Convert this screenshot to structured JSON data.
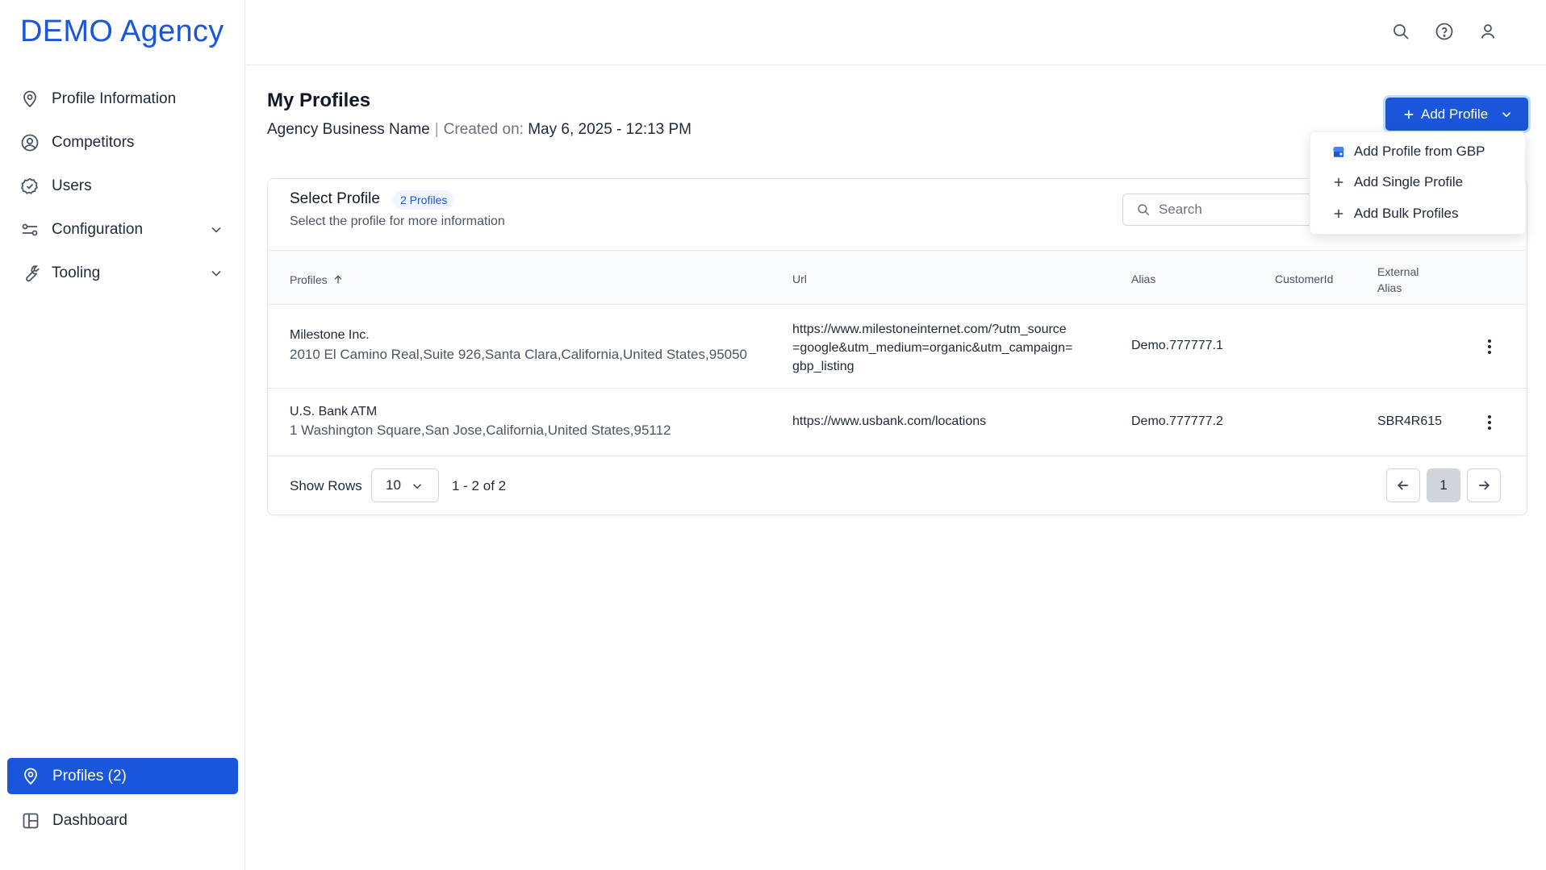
{
  "brand": "DEMO Agency",
  "sidebar": {
    "items": [
      {
        "label": "Profile Information",
        "icon": "map-pin-icon"
      },
      {
        "label": "Competitors",
        "icon": "user-circle-icon"
      },
      {
        "label": "Users",
        "icon": "check-circle-icon"
      },
      {
        "label": "Configuration",
        "icon": "settings-sliders-icon",
        "expandable": true
      },
      {
        "label": "Tooling",
        "icon": "wrench-icon",
        "expandable": true
      }
    ],
    "bottom": [
      {
        "label": "Profiles (2)",
        "icon": "map-pin-icon",
        "active": true
      },
      {
        "label": "Dashboard",
        "icon": "layout-icon"
      }
    ]
  },
  "topbar": {
    "icons": [
      "search-icon",
      "help-icon",
      "user-icon"
    ]
  },
  "header": {
    "title": "My Profiles",
    "business_name": "Agency Business Name",
    "created_label": "Created on:",
    "created_value": "May 6, 2025 - 12:13 PM",
    "add_button": "Add Profile"
  },
  "dropdown": {
    "items": [
      {
        "label": "Add Profile from GBP",
        "icon": "gbp-icon"
      },
      {
        "label": "Add Single Profile",
        "icon": "plus-icon"
      },
      {
        "label": "Add Bulk Profiles",
        "icon": "plus-icon"
      }
    ]
  },
  "card": {
    "title": "Select Profile",
    "badge": "2 Profiles",
    "subtitle": "Select the profile for more information",
    "search_placeholder": "Search"
  },
  "table": {
    "columns": [
      "Profiles",
      "Url",
      "Alias",
      "CustomerId",
      "External",
      "Alias"
    ],
    "rows": [
      {
        "name": "Milestone Inc.",
        "address": "2010 El Camino Real,Suite 926,Santa Clara,California,United States,95050",
        "url_lines": [
          "https://www.milestoneinternet.com/?utm_source",
          "=google&utm_medium=organic&utm_campaign=",
          "gbp_listing"
        ],
        "alias": "Demo.777777.1",
        "customer_id": "",
        "external_alias": ""
      },
      {
        "name": "U.S. Bank ATM",
        "address": "1 Washington Square,San Jose,California,United States,95112",
        "url_lines": [
          "https://www.usbank.com/locations"
        ],
        "alias": "Demo.777777.2",
        "customer_id": "",
        "external_alias": "SBR4R615"
      }
    ]
  },
  "footer": {
    "show_rows_label": "Show Rows",
    "rows_value": "10",
    "range": "1 - 2 of 2",
    "current_page": "1"
  },
  "colors": {
    "accent": "#1a56db",
    "badge_bg": "#eff6ff"
  }
}
